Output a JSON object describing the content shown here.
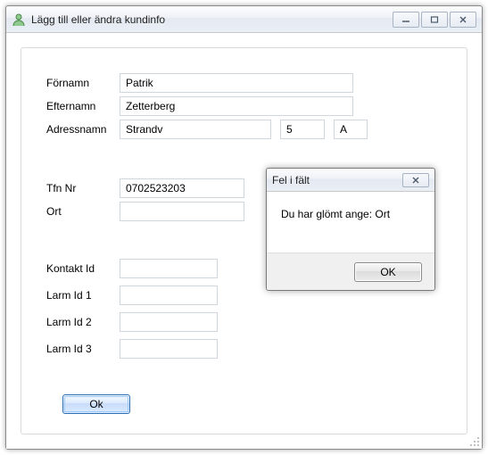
{
  "window": {
    "title": "Lägg till eller ändra kundinfo"
  },
  "form": {
    "fornamn_label": "Förnamn",
    "fornamn_value": "Patrik",
    "efternamn_label": "Efternamn",
    "efternamn_value": "Zetterberg",
    "adressnamn_label": "Adressnamn",
    "adressnamn_value": "Strandv",
    "adressnr_value": "5",
    "adresssuffix_value": "A",
    "tfn_label": "Tfn Nr",
    "tfn_value": "0702523203",
    "ort_label": "Ort",
    "ort_value": "",
    "kontaktid_label": "Kontakt Id",
    "kontaktid_value": "",
    "larm1_label": "Larm Id 1",
    "larm1_value": "",
    "larm2_label": "Larm Id 2",
    "larm2_value": "",
    "larm3_label": "Larm Id 3",
    "larm3_value": "",
    "ok_label": "Ok"
  },
  "dialog": {
    "title": "Fel i fält",
    "message": "Du har glömt ange: Ort",
    "ok_label": "OK"
  },
  "glyphs": {
    "min": "─",
    "max": "▢",
    "close": "✕"
  }
}
